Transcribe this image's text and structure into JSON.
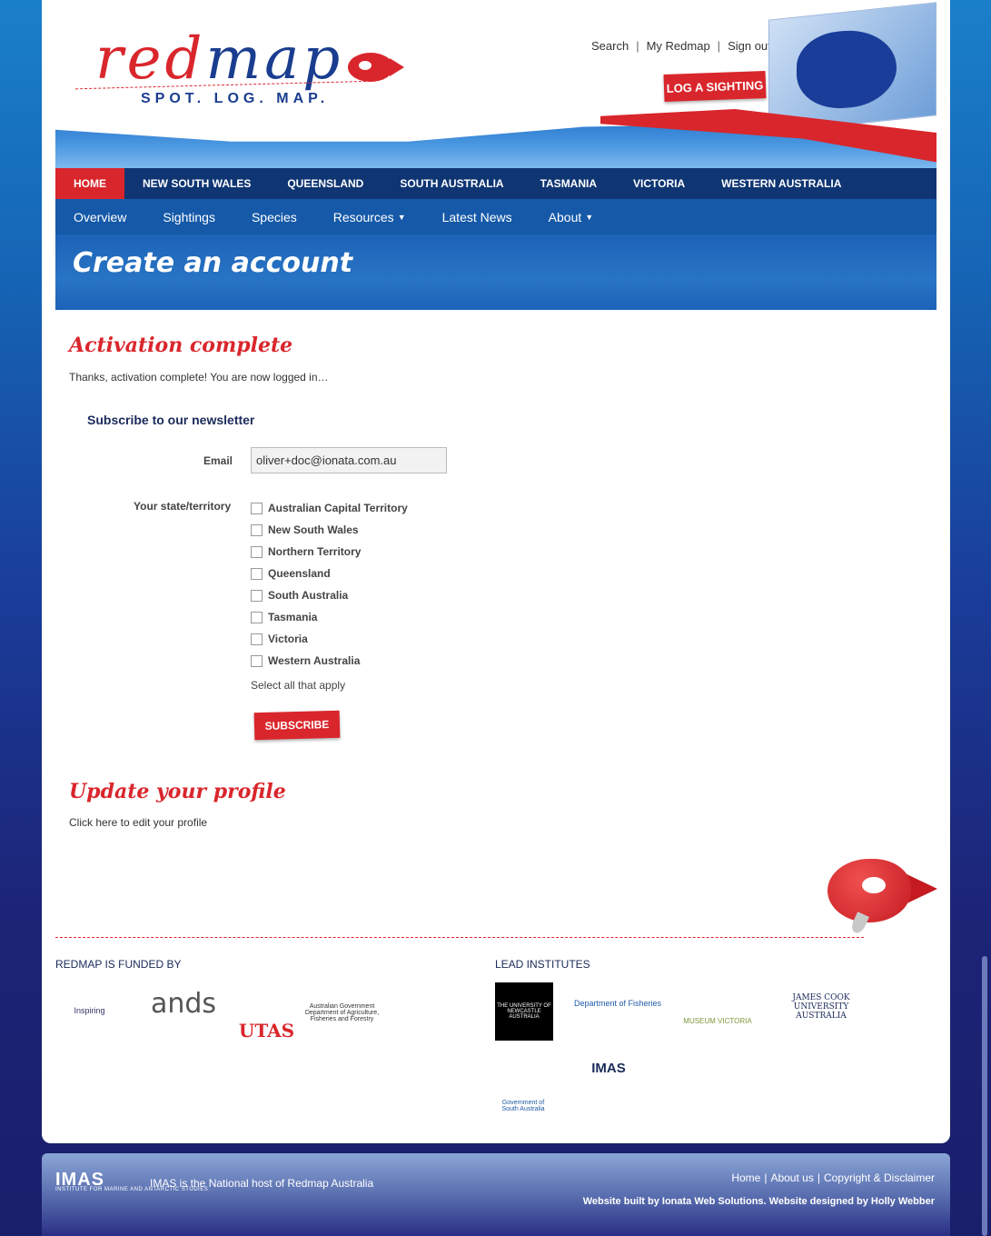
{
  "header": {
    "logo_text_red": "red",
    "logo_text_blue": "map",
    "logo_tagline": "SPOT. LOG. MAP.",
    "top_links": [
      "Search",
      "My Redmap",
      "Sign out"
    ],
    "log_button": "LOG A SIGHTING"
  },
  "state_nav": [
    "HOME",
    "NEW SOUTH WALES",
    "QUEENSLAND",
    "SOUTH AUSTRALIA",
    "TASMANIA",
    "VICTORIA",
    "WESTERN AUSTRALIA"
  ],
  "section_nav": [
    {
      "label": "Overview"
    },
    {
      "label": "Sightings"
    },
    {
      "label": "Species"
    },
    {
      "label": "Resources"
    },
    {
      "label": "Latest News"
    },
    {
      "label": "About"
    }
  ],
  "banner_title": "Create an account",
  "activation": {
    "title": "Activation complete",
    "text": "Thanks, activation complete! You are now logged in…"
  },
  "newsletter": {
    "heading": "Subscribe to our newsletter",
    "email_label": "Email",
    "email_value": "oliver+doc@ionata.com.au",
    "state_label": "Your state/territory",
    "states": [
      "Australian Capital Territory",
      "New South Wales",
      "Northern Territory",
      "Queensland",
      "South Australia",
      "Tasmania",
      "Victoria",
      "Western Australia"
    ],
    "hint": "Select all that apply",
    "subscribe_button": "SUBSCRIBE"
  },
  "profile": {
    "title": "Update your profile",
    "text": "Click here to edit your profile"
  },
  "funded": {
    "heading": "REDMAP IS FUNDED BY",
    "logos": [
      "Inspiring",
      "ands",
      "UTAS",
      "Australian Government Department of Agriculture, Fisheries and Forestry"
    ]
  },
  "lead": {
    "heading": "LEAD INSTITUTES",
    "logos": [
      "THE UNIVERSITY OF NEWCASTLE AUSTRALIA",
      "Department of Fisheries",
      "MUSEUM VICTORIA",
      "JAMES COOK UNIVERSITY AUSTRALIA",
      "Government of South Australia",
      "IMAS"
    ]
  },
  "footer": {
    "imas": "IMAS",
    "imas_sub": "INSTITUTE FOR MARINE AND ANTARCTIC STUDIES",
    "host_text": "IMAS is the National host of Redmap Australia",
    "links": [
      "Home",
      "About us",
      "Copyright & Disclaimer"
    ],
    "built_text": "Website built by Ionata Web Solutions. Website designed by Holly Webber"
  },
  "colors": {
    "accent_red": "#d9262c",
    "nav_dark": "#0f3573",
    "nav_blue": "#1559a8"
  }
}
